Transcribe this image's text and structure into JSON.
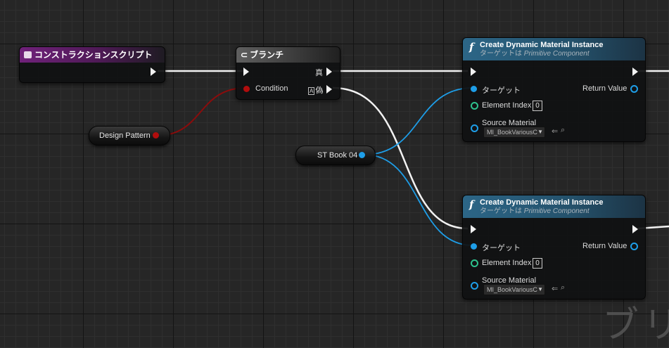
{
  "construction_node": {
    "title": "コンストラクションスクリプト",
    "icon": "construction-script-icon"
  },
  "branch_node": {
    "title": "ブランチ",
    "icon": "branch-icon",
    "condition_label": "Condition",
    "true_label": "真",
    "false_label": "偽",
    "false_prefix": "A"
  },
  "design_pattern_var": {
    "label": "Design Pattern"
  },
  "st_book_var": {
    "label": "ST Book 04"
  },
  "material_nodes": [
    {
      "title": "Create Dynamic Material Instance",
      "subtitle_prefix": "ターゲットは",
      "subtitle_target": "Primitive Component",
      "target_label": "ターゲット",
      "return_label": "Return Value",
      "index_label": "Element Index",
      "index_value": "0",
      "source_label": "Source Material",
      "source_value": "MI_BookVariousC"
    },
    {
      "title": "Create Dynamic Material Instance",
      "subtitle_prefix": "ターゲットは",
      "subtitle_target": "Primitive Component",
      "target_label": "ターゲット",
      "return_label": "Return Value",
      "index_label": "Element Index",
      "index_value": "0",
      "source_label": "Source Material",
      "source_value": "MI_BookVariousC"
    }
  ],
  "watermark": "ブリ",
  "colors": {
    "exec_wire": "#f2f2f2",
    "object_wire": "#1e9ee8",
    "bool_wire": "#8a0c0c",
    "purple_header": "#70217a",
    "function_header": "#2c6687",
    "int_pin": "#2ec28e"
  }
}
